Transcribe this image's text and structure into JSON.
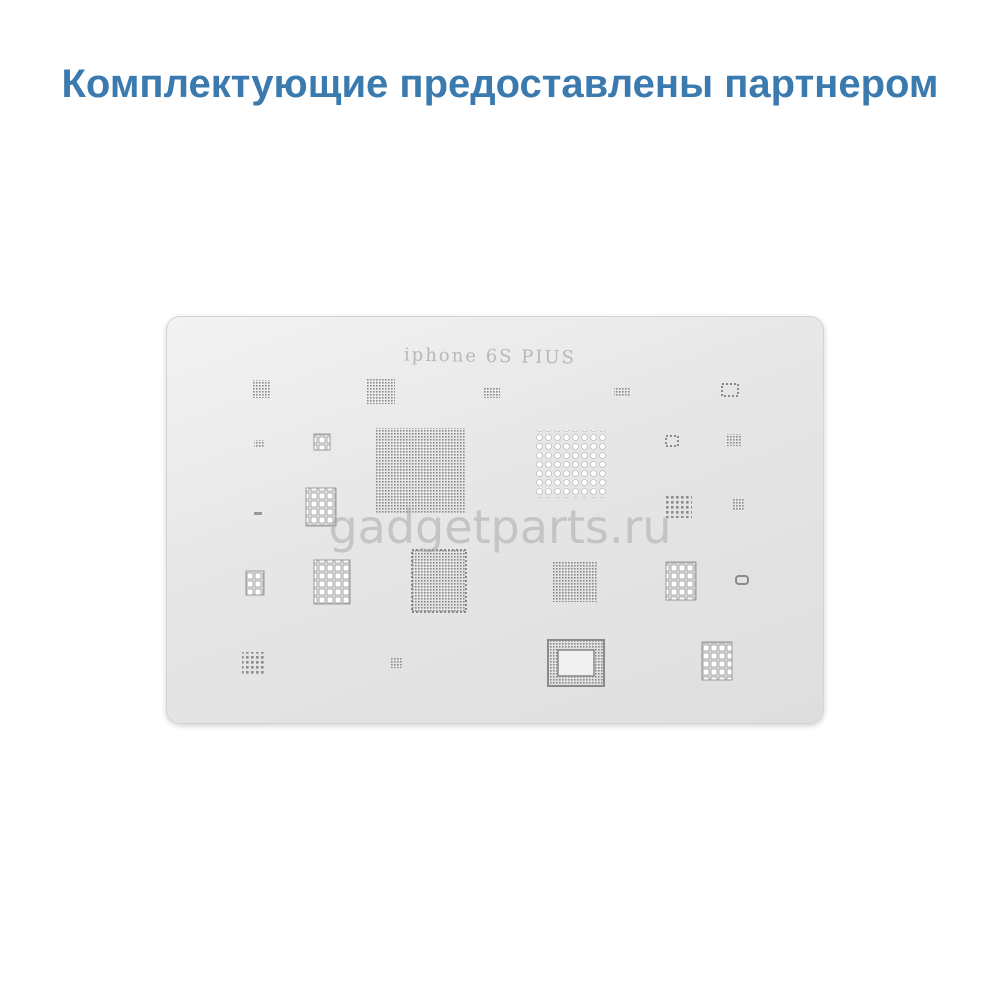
{
  "header": {
    "text": "Комплектующие предоставлены партнером",
    "color": "#3a7aae"
  },
  "stencil": {
    "engraving": "iphone 6S PIUS"
  },
  "watermark": {
    "text": "gadgetparts.ru"
  }
}
